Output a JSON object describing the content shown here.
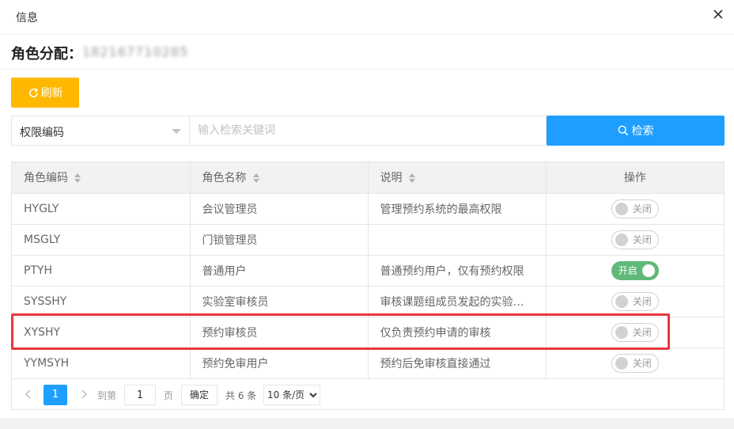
{
  "dialog": {
    "title": "信息"
  },
  "role": {
    "label": "角色分配：",
    "value": "182167710285"
  },
  "toolbar": {
    "refresh_label": "刷新"
  },
  "search": {
    "field_select": "权限编码",
    "placeholder": "输入检索关键词",
    "button_label": "检索"
  },
  "table": {
    "headers": {
      "code": "角色编码",
      "name": "角色名称",
      "desc": "说明",
      "op": "操作"
    },
    "rows": [
      {
        "code": "HYGLY",
        "name": "会议管理员",
        "desc": "管理预约系统的最高权限",
        "status": "关闭"
      },
      {
        "code": "MSGLY",
        "name": "门锁管理员",
        "desc": "",
        "status": "关闭"
      },
      {
        "code": "PTYH",
        "name": "普通用户",
        "desc": "普通预约用户，仅有预约权限",
        "status": "开启"
      },
      {
        "code": "SYSSHY",
        "name": "实验室审核员",
        "desc": "审核课题组成员发起的实验…",
        "status": "关闭"
      },
      {
        "code": "XYSHY",
        "name": "预约审核员",
        "desc": "仅负责预约申请的审核",
        "status": "关闭"
      },
      {
        "code": "YYMSYH",
        "name": "预约免审用户",
        "desc": "预约后免审核直接通过",
        "status": "关闭"
      }
    ]
  },
  "pager": {
    "current": "1",
    "goto_label": "到第",
    "goto_value": "1",
    "page_label": "页",
    "confirm_label": "确定",
    "total_label": "共 6 条",
    "page_size": "10 条/页"
  },
  "colors": {
    "refresh": "#ffb800",
    "search": "#1e9fff",
    "switch_on": "#5fb878",
    "highlight": "#e8383d"
  }
}
